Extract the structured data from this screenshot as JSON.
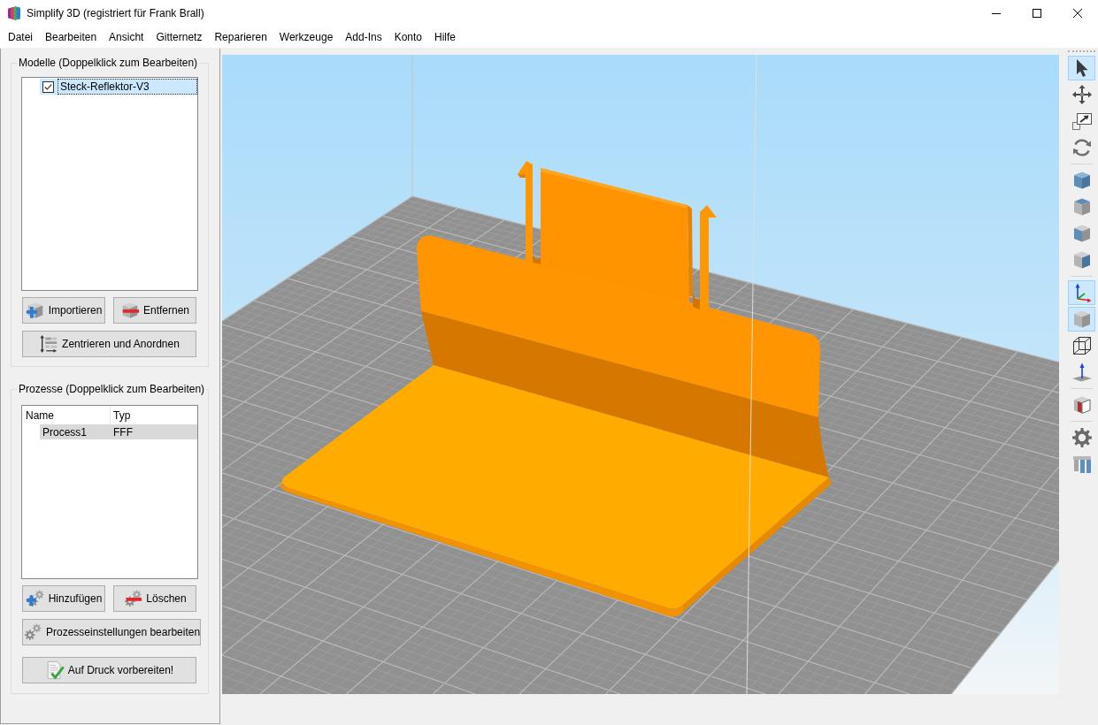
{
  "window": {
    "title": "Simplify 3D (registriert für Frank Brall)"
  },
  "menu": [
    "Datei",
    "Bearbeiten",
    "Ansicht",
    "Gitternetz",
    "Reparieren",
    "Werkzeuge",
    "Add-Ins",
    "Konto",
    "Hilfe"
  ],
  "models_panel": {
    "title": "Modelle (Doppelklick zum Bearbeiten)",
    "items": [
      {
        "name": "Steck-Reflektor-V3",
        "checked": true,
        "selected": true
      }
    ],
    "button_rows": [
      [
        {
          "label": "Importieren",
          "kind": "add-cube"
        },
        {
          "label": "Entfernen",
          "kind": "remove-cube"
        }
      ],
      [
        {
          "label": "Zentrieren und Anordnen",
          "kind": "arrange"
        }
      ]
    ]
  },
  "processes_panel": {
    "title": "Prozesse (Doppelklick zum Bearbeiten)",
    "columns": [
      "Name",
      "Typ"
    ],
    "rows": [
      {
        "cells": [
          "Process1",
          "FFF"
        ],
        "selected": true
      }
    ],
    "button_rows": [
      [
        {
          "label": "Hinzufügen",
          "kind": "add-gear"
        },
        {
          "label": "Löschen",
          "kind": "remove-gear"
        }
      ],
      [
        {
          "label": "Prozesseinstellungen bearbeiten",
          "kind": "gears"
        }
      ],
      [
        {
          "label": "Auf Druck vorbereiten!",
          "kind": "prepare"
        }
      ]
    ]
  },
  "toolbar": {
    "groups": [
      [
        {
          "kind": "pointer",
          "selected": true
        },
        {
          "kind": "move",
          "selected": false
        },
        {
          "kind": "scale",
          "selected": false
        },
        {
          "kind": "rotate",
          "selected": false
        }
      ],
      [
        {
          "kind": "view-iso",
          "selected": false
        },
        {
          "kind": "view-top",
          "selected": false
        },
        {
          "kind": "view-front",
          "selected": false
        },
        {
          "kind": "view-side",
          "selected": false
        }
      ],
      [
        {
          "kind": "axes",
          "selected": true
        },
        {
          "kind": "solid",
          "selected": true
        },
        {
          "kind": "wireframe",
          "selected": false
        },
        {
          "kind": "normals",
          "selected": false
        }
      ],
      [
        {
          "kind": "cross-section",
          "selected": false
        }
      ],
      [
        {
          "kind": "settings",
          "selected": false
        },
        {
          "kind": "supports",
          "selected": false
        }
      ]
    ]
  }
}
